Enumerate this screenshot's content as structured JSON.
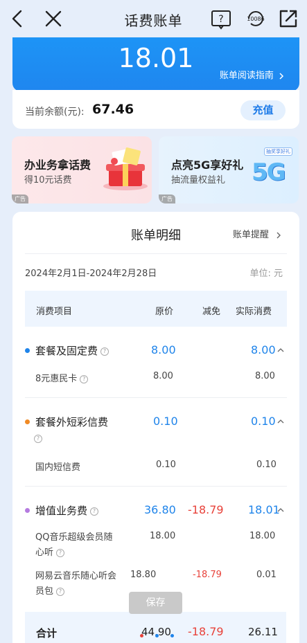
{
  "nav": {
    "title": "话费账单",
    "service_number": "10086"
  },
  "bill": {
    "amount": "18.01",
    "guide_link": "账单阅读指南",
    "balance_label": "当前余额(元):",
    "balance_value": "67.46",
    "recharge_label": "充值"
  },
  "promos": [
    {
      "title": "办业务拿话费",
      "subtitle": "得10元话费",
      "ad_tag": "广告"
    },
    {
      "title": "点亮5G享好礼",
      "subtitle": "抽流量权益礼",
      "ad_tag": "广告",
      "badge": "抽奖享好礼",
      "logo": "5G"
    }
  ],
  "detail": {
    "title": "账单明细",
    "remind_link": "账单提醒",
    "date_range": "2024年2月1日-2024年2月28日",
    "unit": "单位: 元",
    "headers": [
      "消费项目",
      "原价",
      "减免",
      "实际消费"
    ],
    "categories": [
      {
        "name": "套餐及固定费",
        "dot_color": "#1f84ea",
        "original": "8.00",
        "discount": "",
        "actual": "8.00",
        "items": [
          {
            "name": "8元惠民卡",
            "original": "8.00",
            "discount": "",
            "actual": "8.00"
          }
        ]
      },
      {
        "name": "套餐外短彩信费",
        "dot_color": "#f08a24",
        "original": "0.10",
        "discount": "",
        "actual": "0.10",
        "items": [
          {
            "name": "国内短信费",
            "original": "0.10",
            "discount": "",
            "actual": "0.10"
          }
        ]
      },
      {
        "name": "增值业务费",
        "dot_color": "#b57be0",
        "original": "36.80",
        "discount": "-18.79",
        "actual": "18.01",
        "items": [
          {
            "name_line1": "QQ音乐超级会员随",
            "name_line2": "心听",
            "original": "18.00",
            "discount": "",
            "actual": "18.00"
          },
          {
            "name_line1": "网易云音乐随心听会",
            "name_line2": "员包",
            "original": "18.80",
            "discount": "-18.79",
            "actual": "0.01"
          }
        ]
      }
    ],
    "total": {
      "label": "合计",
      "original": "44.90",
      "discount": "-18.79",
      "actual": "26.11"
    }
  },
  "save_label": "保存",
  "colors": {
    "accent": "#1f84ea",
    "discount": "#e8423a",
    "background": "#e6eefa"
  }
}
